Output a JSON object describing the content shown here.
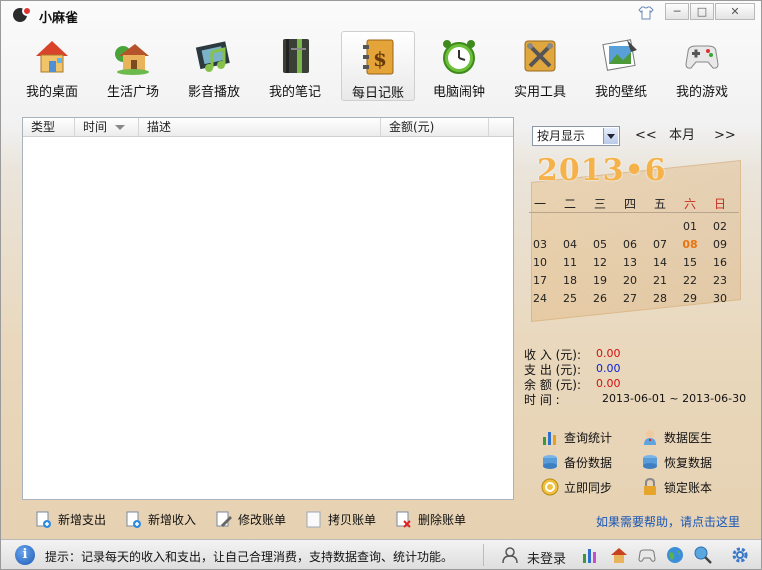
{
  "window": {
    "title": "小麻雀",
    "controls": {
      "skin": "skin-icon",
      "restore": "□",
      "close": "✕",
      "minimize": "─"
    }
  },
  "toolbar": {
    "items": [
      {
        "label": "我的桌面",
        "icon": "house-icon"
      },
      {
        "label": "生活广场",
        "icon": "cottage-icon"
      },
      {
        "label": "影音播放",
        "icon": "film-icon"
      },
      {
        "label": "我的笔记",
        "icon": "notebook-icon"
      },
      {
        "label": "每日记账",
        "icon": "ledger-dollar-icon",
        "active": true
      },
      {
        "label": "电脑闹钟",
        "icon": "alarm-clock-icon"
      },
      {
        "label": "实用工具",
        "icon": "tools-icon"
      },
      {
        "label": "我的壁纸",
        "icon": "wallpaper-icon"
      },
      {
        "label": "我的游戏",
        "icon": "gamepad-icon"
      }
    ]
  },
  "list": {
    "columns": [
      "类型",
      "时间",
      "描述",
      "金额(元)"
    ],
    "rows": []
  },
  "list_actions": {
    "add_expense": "新增支出",
    "add_income": "新增收入",
    "edit": "修改账单",
    "copy": "拷贝账单",
    "delete": "删除账单"
  },
  "calendar": {
    "view_mode": "按月显示",
    "prev": "<<",
    "current": "本月",
    "next": ">>",
    "year_month": "2013•6",
    "weekdays": [
      "一",
      "二",
      "三",
      "四",
      "五",
      "六",
      "日"
    ],
    "weekend_color": "#cc2a1d",
    "days": [
      [
        null,
        null,
        null,
        null,
        null,
        "01",
        "02"
      ],
      [
        "03",
        "04",
        "05",
        "06",
        "07",
        "08",
        "09"
      ],
      [
        "10",
        "11",
        "12",
        "13",
        "14",
        "15",
        "16"
      ],
      [
        "17",
        "18",
        "19",
        "20",
        "21",
        "22",
        "23"
      ],
      [
        "24",
        "25",
        "26",
        "27",
        "28",
        "29",
        "30"
      ]
    ],
    "today": "08",
    "today_color": "#e8730f"
  },
  "summary": {
    "income_label": "收 入 (元):",
    "income_value": "0.00",
    "income_color": "#d01010",
    "expense_label": "支 出 (元):",
    "expense_value": "0.00",
    "expense_color": "#1020d0",
    "balance_label": "余 额 (元):",
    "balance_value": "0.00",
    "balance_color": "#d01010",
    "period_label": "时 间 :",
    "period_value": "2013-06-01 ~ 2013-06-30"
  },
  "functions": {
    "query_stats": "查询统计",
    "data_doctor": "数据医生",
    "backup": "备份数据",
    "restore": "恢复数据",
    "sync": "立即同步",
    "lock": "锁定账本"
  },
  "help_link": "如果需要帮助，请点击这里",
  "status": {
    "tip": "提示：记录每天的收入和支出，让自己合理消费，支持数据查询、统计功能。",
    "login": "未登录",
    "info_icon": "i"
  }
}
